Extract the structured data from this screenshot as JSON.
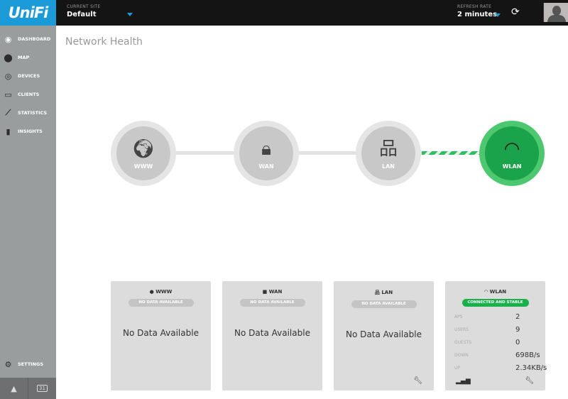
{
  "header": {
    "logo": "UniFi",
    "site_label": "CURRENT SITE",
    "site_value": "Default",
    "refresh_label": "REFRESH RATE",
    "refresh_value": "2 minutes"
  },
  "sidebar": {
    "items": [
      {
        "label": "DASHBOARD",
        "icon": "dashboard-icon"
      },
      {
        "label": "MAP",
        "icon": "map-pin-icon"
      },
      {
        "label": "DEVICES",
        "icon": "devices-icon"
      },
      {
        "label": "CLIENTS",
        "icon": "laptop-icon"
      },
      {
        "label": "STATISTICS",
        "icon": "line-chart-icon"
      },
      {
        "label": "INSIGHTS",
        "icon": "bar-chart-icon"
      }
    ],
    "settings": "SETTINGS",
    "calendar": "31"
  },
  "page_title": "Network Health",
  "nodes": [
    {
      "label": "WWW",
      "status": "unknown"
    },
    {
      "label": "WAN",
      "status": "unknown"
    },
    {
      "label": "LAN",
      "status": "unknown"
    },
    {
      "label": "WLAN",
      "status": "ok"
    }
  ],
  "cards": [
    {
      "title": "WWW",
      "badge": "NO DATA AVAILABLE",
      "message": "No Data Available"
    },
    {
      "title": "WAN",
      "badge": "NO DATA AVAILABLE",
      "message": "No Data Available"
    },
    {
      "title": "LAN",
      "badge": "NO DATA AVAILABLE",
      "message": "No Data Available"
    },
    {
      "title": "WLAN",
      "badge": "CONNECTED AND STABLE",
      "stats": [
        {
          "k": "APS",
          "v": "2"
        },
        {
          "k": "USERS",
          "v": "9"
        },
        {
          "k": "GUESTS",
          "v": "0"
        },
        {
          "k": "DOWN",
          "v": "698B/s"
        },
        {
          "k": "UP",
          "v": "2.34KB/s"
        }
      ]
    }
  ],
  "colors": {
    "brand": "#1a9ad6",
    "ok": "#1aa34a"
  }
}
